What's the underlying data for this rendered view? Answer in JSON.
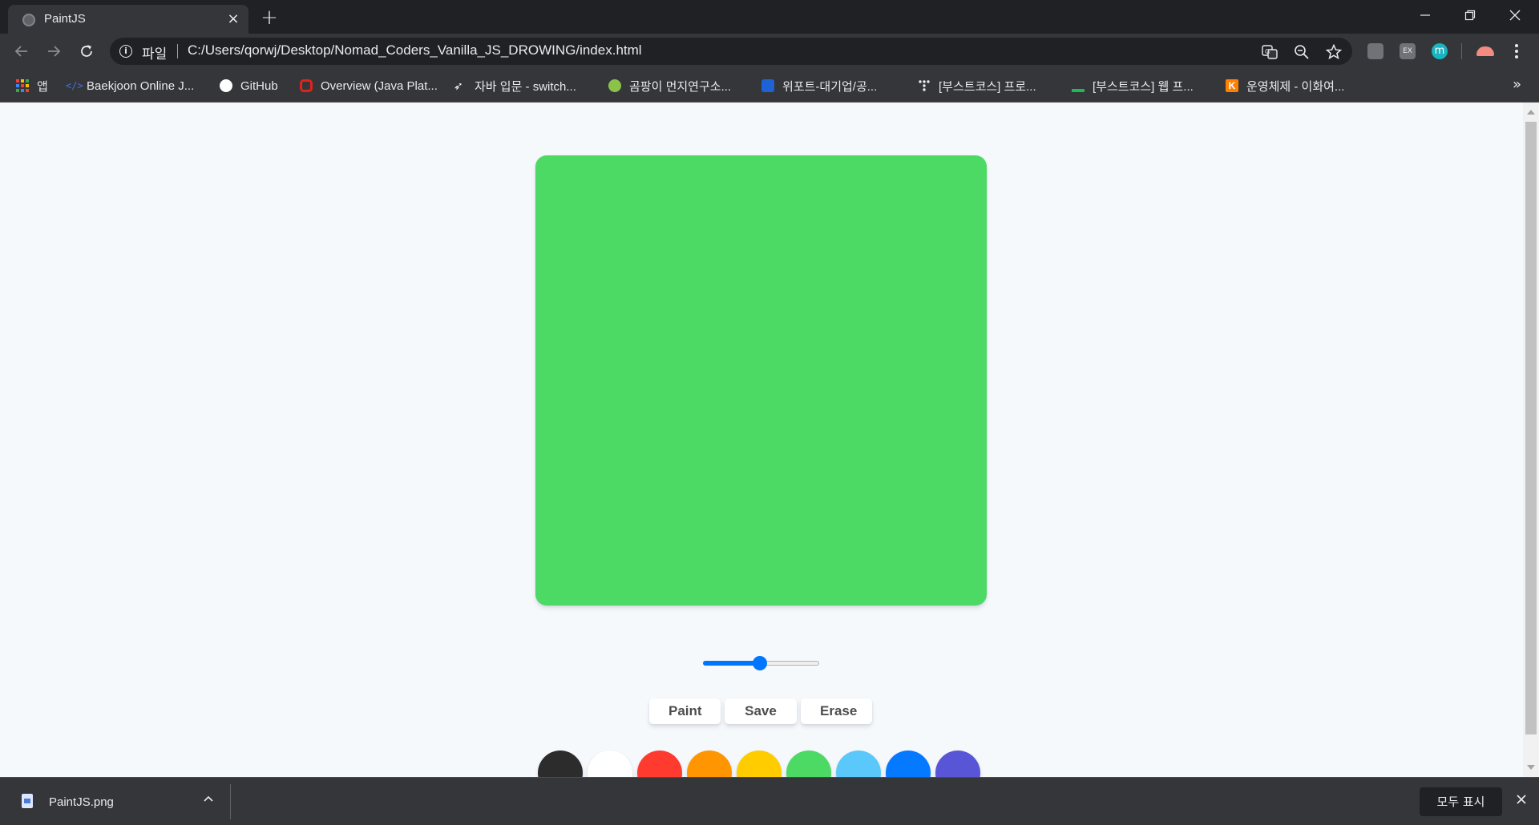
{
  "browser": {
    "tab": {
      "title": "PaintJS",
      "close": "×"
    },
    "new_tab": "+",
    "address": {
      "scheme": "파일",
      "url": "C:/Users/qorwj/Desktop/Nomad_Coders_Vanilla_JS_DROWING/index.html"
    },
    "bookmarks": [
      {
        "label": "앱",
        "icon": "apps-grid-icon",
        "color": "#ea4335"
      },
      {
        "label": "Baekjoon Online J...",
        "icon": "code-icon",
        "color": "#3b5998"
      },
      {
        "label": "GitHub",
        "icon": "github-icon",
        "color": "#ffffff"
      },
      {
        "label": "Overview (Java Plat...",
        "icon": "oracle-icon",
        "color": "#e2231a"
      },
      {
        "label": "자바 입문 - switch...",
        "icon": "bird-icon",
        "color": "#ffffff"
      },
      {
        "label": "곰팡이 먼지연구소...",
        "icon": "leaf-icon",
        "color": "#8bc34a"
      },
      {
        "label": "위포트-대기업/공...",
        "icon": "wepot-icon",
        "color": "#1e63d6"
      },
      {
        "label": "[부스트코스] 프로...",
        "icon": "dots-icon",
        "color": "#e8eaed"
      },
      {
        "label": "[부스트코스] 웹 프...",
        "icon": "green-bar-icon",
        "color": "#1db954"
      },
      {
        "label": "운영체제 - 이화여...",
        "icon": "k-icon",
        "color": "#ff7f00"
      }
    ],
    "bookmarks_more": "»"
  },
  "app": {
    "canvas_color": "#4cd964",
    "brush_range": {
      "value": 0.49
    },
    "buttons": {
      "paint": "Paint",
      "save": "Save",
      "erase": "Erase"
    },
    "palette": [
      "#2c2c2c",
      "#ffffff",
      "#ff3b30",
      "#ff9500",
      "#ffcc00",
      "#4cd964",
      "#5ac8fa",
      "#0579ff",
      "#5856d6"
    ]
  },
  "downloads": {
    "file_name": "PaintJS.png",
    "show_all": "모두 표시"
  }
}
